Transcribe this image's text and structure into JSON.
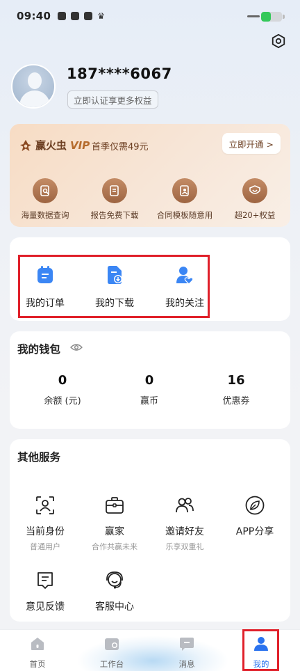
{
  "status_bar": {
    "time": "09:40",
    "battery_level": 0.45
  },
  "profile": {
    "phone": "187****6067",
    "verify_label": "立即认证享更多权益"
  },
  "vip": {
    "brand": "赢火虫",
    "tag": "VIP",
    "promo": "首季仅需49元",
    "open_button": "立即开通 >",
    "benefits": [
      {
        "label": "海量数据查询",
        "icon": "data-search-icon"
      },
      {
        "label": "报告免费下载",
        "icon": "report-download-icon"
      },
      {
        "label": "合同模板随意用",
        "icon": "contract-template-icon"
      },
      {
        "label": "超20+权益",
        "icon": "heart-badge-icon"
      }
    ]
  },
  "quick_actions": [
    {
      "label": "我的订单",
      "icon": "order-icon"
    },
    {
      "label": "我的下载",
      "icon": "download-icon"
    },
    {
      "label": "我的关注",
      "icon": "follow-icon"
    }
  ],
  "wallet": {
    "title": "我的钱包",
    "items": [
      {
        "value": "0",
        "label": "余额 (元)"
      },
      {
        "value": "0",
        "label": "赢币"
      },
      {
        "value": "16",
        "label": "优惠券"
      }
    ]
  },
  "services": {
    "title": "其他服务",
    "items": [
      {
        "label": "当前身份",
        "sub": "普通用户",
        "icon": "identity-icon"
      },
      {
        "label": "赢家",
        "sub": "合作共赢未来",
        "icon": "briefcase-icon"
      },
      {
        "label": "邀请好友",
        "sub": "乐享双重礼",
        "icon": "invite-friends-icon"
      },
      {
        "label": "APP分享",
        "sub": "",
        "icon": "leaf-share-icon"
      },
      {
        "label": "意见反馈",
        "sub": "",
        "icon": "feedback-icon"
      },
      {
        "label": "客服中心",
        "sub": "",
        "icon": "customer-service-icon"
      }
    ]
  },
  "tabbar": [
    {
      "label": "首页",
      "icon": "home-icon"
    },
    {
      "label": "工作台",
      "icon": "workbench-icon"
    },
    {
      "label": "消息",
      "icon": "message-icon"
    },
    {
      "label": "我的",
      "icon": "profile-icon",
      "active": true
    }
  ],
  "colors": {
    "accent": "#2a72ee",
    "vip_brown": "#9d6441",
    "highlight_red": "#e0202a"
  }
}
